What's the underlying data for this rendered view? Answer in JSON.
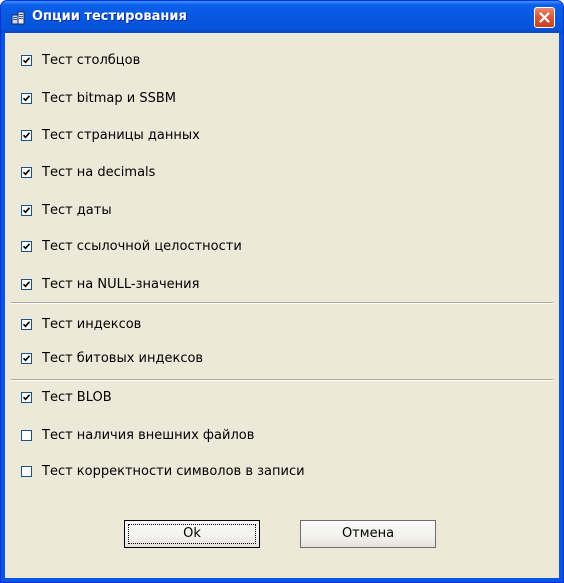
{
  "window": {
    "title": "Опции тестирования",
    "titlebar_color": "#0a54e3",
    "background": "#ece9d8",
    "icon": "app-icon",
    "close_icon": "close-icon"
  },
  "options": [
    {
      "label": "Тест столбцов",
      "checked": true
    },
    {
      "label": "Тест bitmap и SSBM",
      "checked": true
    },
    {
      "label": "Тест страницы данных",
      "checked": true
    },
    {
      "label": "Тест на decimals",
      "checked": true
    },
    {
      "label": "Тест даты",
      "checked": true
    },
    {
      "label": "Тест ссылочной целостности",
      "checked": true
    },
    {
      "label": "Тест на NULL-значения",
      "checked": true
    },
    {
      "label": "Тест индексов",
      "checked": true
    },
    {
      "label": "Тест битовых индексов",
      "checked": true
    },
    {
      "label": "Тест BLOB",
      "checked": true
    },
    {
      "label": "Тест наличия внешних файлов",
      "checked": false
    },
    {
      "label": "Тест корректности символов в записи",
      "checked": false
    }
  ],
  "buttons": {
    "ok": "Ok",
    "cancel": "Отмена"
  }
}
